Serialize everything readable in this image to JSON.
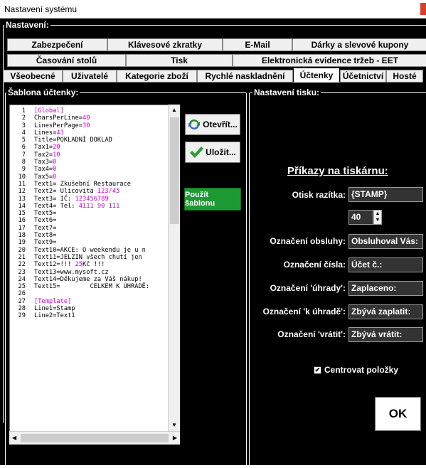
{
  "window": {
    "title": "Nastavení systému"
  },
  "settings_group": {
    "label": "Nastavení:"
  },
  "tabs": {
    "row1": [
      "Zabezpečení",
      "Klávesové zkratky",
      "E-Mail",
      "Dárky a slevové kupony"
    ],
    "row2": [
      "Časování stolů",
      "Tisk",
      "Elektronická evidence tržeb - EET"
    ],
    "row3": [
      "Všeobecné",
      "Uživatelé",
      "Kategorie zboží",
      "Rychlé naskladnění",
      "Účtenky",
      "Účetnictví",
      "Hosté"
    ],
    "active": "Účtenky"
  },
  "template_group": {
    "label": "Šablona účtenky:"
  },
  "editor": {
    "line_numbers": [
      "1",
      "2",
      "3",
      "4",
      "5",
      "6",
      "7",
      "8",
      "9",
      "10",
      "11",
      "12",
      "13",
      "14",
      "15",
      "16",
      "17",
      "18",
      "19",
      "20",
      "21",
      "22",
      "23",
      "24",
      "25",
      "26",
      "27",
      "28",
      "29"
    ],
    "lines": [
      [
        {
          "t": "[Global]",
          "c": "#cc00cc"
        }
      ],
      [
        {
          "t": "CharsPerLine=",
          "c": "#000000"
        },
        {
          "t": "40",
          "c": "#cc00cc"
        }
      ],
      [
        {
          "t": "LinesPerPage=",
          "c": "#000000"
        },
        {
          "t": "30",
          "c": "#cc00cc"
        }
      ],
      [
        {
          "t": "Lines=",
          "c": "#000000"
        },
        {
          "t": "43",
          "c": "#cc00cc"
        }
      ],
      [
        {
          "t": "Title=POKLADNÍ DOKLAD",
          "c": "#000000"
        }
      ],
      [
        {
          "t": "Tax1=",
          "c": "#000000"
        },
        {
          "t": "20",
          "c": "#cc00cc"
        }
      ],
      [
        {
          "t": "Tax2=",
          "c": "#000000"
        },
        {
          "t": "10",
          "c": "#cc00cc"
        }
      ],
      [
        {
          "t": "Tax3=",
          "c": "#000000"
        },
        {
          "t": "0",
          "c": "#cc00cc"
        }
      ],
      [
        {
          "t": "Tax4=",
          "c": "#000000"
        },
        {
          "t": "0",
          "c": "#cc00cc"
        }
      ],
      [
        {
          "t": "Tax5=",
          "c": "#000000"
        },
        {
          "t": "0",
          "c": "#cc00cc"
        }
      ],
      [
        {
          "t": "Text1= Zkušební Restaurace",
          "c": "#000000"
        }
      ],
      [
        {
          "t": "Text2= Ulicovitá ",
          "c": "#000000"
        },
        {
          "t": "123/45",
          "c": "#cc00cc"
        }
      ],
      [
        {
          "t": "Text3= IČ: ",
          "c": "#000000"
        },
        {
          "t": "123456789",
          "c": "#cc00cc"
        }
      ],
      [
        {
          "t": "Text4= Tel: ",
          "c": "#000000"
        },
        {
          "t": "4111 90 111",
          "c": "#cc00cc"
        }
      ],
      [
        {
          "t": "Text5=",
          "c": "#000000"
        }
      ],
      [
        {
          "t": "Text6=",
          "c": "#000000"
        }
      ],
      [
        {
          "t": "Text7=",
          "c": "#000000"
        }
      ],
      [
        {
          "t": "Text8=",
          "c": "#000000"
        }
      ],
      [
        {
          "t": "Text9=",
          "c": "#000000"
        }
      ],
      [
        {
          "t": "Text10=AKCE: O weekendu je u n",
          "c": "#000000"
        }
      ],
      [
        {
          "t": "Text11=JELZIN všech chutí jen",
          "c": "#000000"
        }
      ],
      [
        {
          "t": "Text12=!!! ",
          "c": "#000000"
        },
        {
          "t": "25",
          "c": "#cc00cc"
        },
        {
          "t": "Kč !!!",
          "c": "#000000"
        }
      ],
      [
        {
          "t": "Text13=www.mysoft.cz",
          "c": "#000000"
        }
      ],
      [
        {
          "t": "Text14=Děkujeme za Váš nákup!",
          "c": "#000000"
        }
      ],
      [
        {
          "t": "Text15=        CELKEM K ÚHRADĚ:",
          "c": "#000000"
        }
      ],
      [
        {
          "t": "",
          "c": "#000000"
        }
      ],
      [
        {
          "t": "[Template]",
          "c": "#cc00cc"
        }
      ],
      [
        {
          "t": "Line1=Stamp",
          "c": "#000000"
        }
      ],
      [
        {
          "t": "Line2=Text1",
          "c": "#000000"
        }
      ]
    ]
  },
  "buttons": {
    "open": "Otevřít...",
    "save": "Uložit...",
    "use_template": "Použít šablonu",
    "ok": "OK"
  },
  "print_group": {
    "label": "Nastavení tisku:",
    "heading": "Příkazy na tiskárnu:",
    "stamp_label": "Otisk razítka:",
    "stamp_value": "{STAMP}",
    "spin_value": "40",
    "staff_label": "Označení obsluhy:",
    "staff_value": "Obsluhoval Vás:",
    "number_label": "Označení čísla:",
    "number_value": "Účet č.:",
    "paid_label": "Označení 'úhrady':",
    "paid_value": "Zaplaceno:",
    "topay_label": "Označení 'k úhradě':",
    "topay_value": "Zbývá zaplatit:",
    "return_label": "Označení 'vrátit':",
    "return_value": "Zbývá vrátit:",
    "center_items_label": "Centrovat položky",
    "center_items_checked": true
  },
  "colors": {
    "accent_green": "#1e9a32",
    "close_red": "#e03c2c",
    "keyword_magenta": "#cc00cc"
  }
}
